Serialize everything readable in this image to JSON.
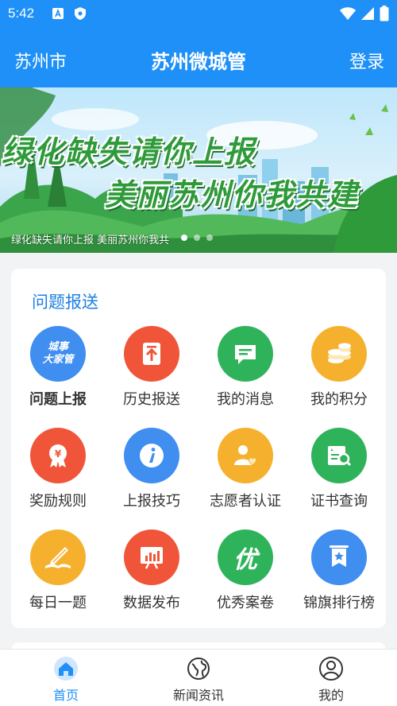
{
  "status_bar": {
    "time": "5:42"
  },
  "app_bar": {
    "city": "苏州市",
    "title": "苏州微城管",
    "login": "登录"
  },
  "banner": {
    "line1": "绿化缺失请你上报",
    "line2": "美丽苏州你我共建",
    "caption": "绿化缺失请你上报 美丽苏州你我共",
    "slide_count": 3,
    "active_slide": 1
  },
  "section": {
    "title": "问题报送",
    "items": [
      {
        "label": "问题上报",
        "icon": "city-affairs-icon",
        "badge": "城事\n大家管",
        "color": "#3f8ef0"
      },
      {
        "label": "历史报送",
        "icon": "history-upload-icon",
        "color": "#f0553a"
      },
      {
        "label": "我的消息",
        "icon": "message-icon",
        "color": "#2fb35a"
      },
      {
        "label": "我的积分",
        "icon": "coins-icon",
        "color": "#f5b12d"
      },
      {
        "label": "奖励规则",
        "icon": "reward-badge-icon",
        "color": "#f0553a"
      },
      {
        "label": "上报技巧",
        "icon": "info-icon",
        "color": "#3f8ef0"
      },
      {
        "label": "志愿者认证",
        "icon": "volunteer-icon",
        "color": "#f5b12d"
      },
      {
        "label": "证书查询",
        "icon": "certificate-search-icon",
        "color": "#2fb35a"
      },
      {
        "label": "每日一题",
        "icon": "book-pen-icon",
        "color": "#f5b12d"
      },
      {
        "label": "数据发布",
        "icon": "chart-board-icon",
        "color": "#f0553a"
      },
      {
        "label": "优秀案卷",
        "icon": "excellent-icon",
        "badge": "优",
        "color": "#2fb35a"
      },
      {
        "label": "锦旗排行榜",
        "icon": "banner-flag-icon",
        "color": "#3f8ef0"
      }
    ]
  },
  "tabs": [
    {
      "label": "首页",
      "icon": "home-icon",
      "active": true
    },
    {
      "label": "新闻资讯",
      "icon": "globe-icon",
      "active": false
    },
    {
      "label": "我的",
      "icon": "user-icon",
      "active": false
    }
  ],
  "colors": {
    "primary": "#1e90f8",
    "section_title": "#1e7fe0"
  }
}
